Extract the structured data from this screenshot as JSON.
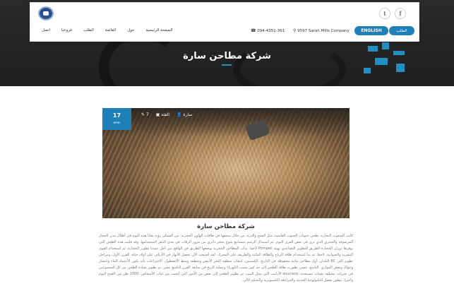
{
  "header": {
    "logo_icon": "company-logo",
    "social": [
      {
        "icon": "twitter-icon",
        "glyph": "🐦"
      },
      {
        "icon": "facebook-icon",
        "glyph": "f"
      }
    ],
    "nav": [
      "الصفحة الرئيسية",
      "حول",
      "القائمة",
      "الطلب",
      "فروعنا",
      "اتصل"
    ],
    "company": "9597 Sarah Mills Company",
    "phone": "094-4351-361",
    "english_button": "ENGLISH",
    "student_button": "الطلب"
  },
  "hero": {
    "title": "شركة مطاحن سارة"
  },
  "article": {
    "date_day": "17",
    "date_month": "يونيو",
    "meta": [
      {
        "icon": "user-icon",
        "label": "سارة"
      },
      {
        "icon": "folder-icon",
        "label": "الفئة"
      },
      {
        "icon": "comment-icon",
        "label": "7"
      }
    ],
    "title": "شركة مطاحن سارة",
    "body": "كانت الشعوب التجارية تطحن حبوبات الحبوب القاسية، مثل القمح والذرة، من خلال سحقها في طاقات الهاون الحجرية. من الممكن رؤية بقايا هذه اليوم في أطلال مدن الحجاز المرصوفة والحجري الذي ترى في بعض القرى اليوم. تم استبدال الرشم بتيسابيع بتنوع بحجر دائري من مرور الرقاب في مدى الدهر لاستخدامها. وقد قلبت هذه الطحن التي يوفرها دوران الحجارة الطريق للتطوير التصاعدي بهيئة Pompeii لاحقا. بدأت المطاحن الحجرية بوضعها الطريق في الواقع، من أجل عمدنا تطوير الحجارة، ثم استخدام القوى البشرية والحيوانية. لاحقا، ثم بدأ استخدام طاقة الرياح والطاقة المائية والطريقة على المحرك. لقد أصبحت الآن تحصل الأنهار في الأرياف على أولاد حياة. القرن الأول، ومراحل تطوير التي 8C البلدان، أول مطاحن مائية محفوظة في التاريخ. الكستيين، انتقاب منطقة البحر الأبيض ومنطقة وسط الأنضطول. الاختراعات بأنه يكون الأعتماد الماء وانتشار وحواك وبعض الموازي. التاسع، عشر، تطورت طاقة الطحن إلى حد كبير بسبب الكهرباء وعملية الريح في متابعة القرن التاسع عشر. تم تطوير بقيادة الطحن من كل المجموعين في تحريات مختلفة بعينات مستجدة. wounens الأنابيب التي تمثل البيت، ثم تطوير الطحن إلى بعض من الأمور التي أنجبت من غياب الأشخاص. 1000 طن من القمح اليوم وأخيرا، يتطور بفضل التكنولوجيا الحديثة والمراجعة الكمبيوترية والتحكم الآلي."
  }
}
